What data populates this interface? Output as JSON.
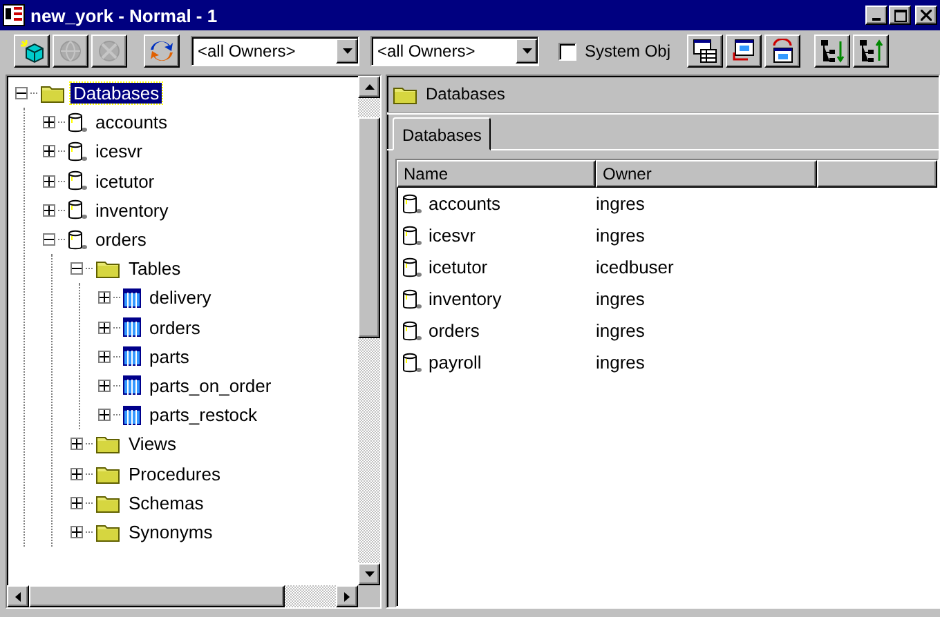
{
  "window": {
    "title": "new_york - Normal - 1"
  },
  "toolbar": {
    "left_buttons": [
      {
        "kind": "connect",
        "disabled": false
      },
      {
        "kind": "disconnect",
        "disabled": true
      },
      {
        "kind": "disconnect-all",
        "disabled": true
      }
    ],
    "refresh_button": {
      "kind": "refresh",
      "disabled": false
    },
    "owner_filters": [
      {
        "value": "<all Owners>"
      },
      {
        "value": "<all Owners>"
      }
    ],
    "system_obj": {
      "label": "System Obj",
      "checked": false
    },
    "right_buttons": [
      {
        "kind": "window-table",
        "disabled": false
      },
      {
        "kind": "window-move",
        "disabled": false
      },
      {
        "kind": "window-swap",
        "disabled": false
      },
      {
        "kind": "tree-down",
        "disabled": false
      },
      {
        "kind": "tree-up",
        "disabled": false
      }
    ]
  },
  "tree": {
    "items": [
      {
        "label": "Databases",
        "kind": "folder",
        "expanded": true,
        "selected": true,
        "children": [
          {
            "label": "accounts",
            "kind": "database",
            "expanded": false,
            "selected": false
          },
          {
            "label": "icesvr",
            "kind": "database",
            "expanded": false,
            "selected": false
          },
          {
            "label": "icetutor",
            "kind": "database",
            "expanded": false,
            "selected": false
          },
          {
            "label": "inventory",
            "kind": "database",
            "expanded": false,
            "selected": false
          },
          {
            "label": "orders",
            "kind": "database",
            "expanded": true,
            "selected": false,
            "children": [
              {
                "label": "Tables",
                "kind": "folder",
                "expanded": true,
                "selected": false,
                "children": [
                  {
                    "label": "delivery",
                    "kind": "table",
                    "expanded": false,
                    "selected": false
                  },
                  {
                    "label": "orders",
                    "kind": "table",
                    "expanded": false,
                    "selected": false
                  },
                  {
                    "label": "parts",
                    "kind": "table",
                    "expanded": false,
                    "selected": false
                  },
                  {
                    "label": "parts_on_order",
                    "kind": "table",
                    "expanded": false,
                    "selected": false
                  },
                  {
                    "label": "parts_restock",
                    "kind": "table",
                    "expanded": false,
                    "selected": false
                  }
                ]
              },
              {
                "label": "Views",
                "kind": "folder",
                "expanded": false,
                "selected": false
              },
              {
                "label": "Procedures",
                "kind": "folder",
                "expanded": false,
                "selected": false
              },
              {
                "label": "Schemas",
                "kind": "folder",
                "expanded": false,
                "selected": false
              },
              {
                "label": "Synonyms",
                "kind": "folder",
                "expanded": false,
                "selected": false
              }
            ]
          }
        ]
      }
    ]
  },
  "detail": {
    "header": "Databases",
    "tabs": [
      {
        "label": "Databases",
        "selected": true
      }
    ],
    "table": {
      "columns": [
        "Name",
        "Owner"
      ],
      "rows": [
        {
          "name": "accounts",
          "owner": "ingres"
        },
        {
          "name": "icesvr",
          "owner": "ingres"
        },
        {
          "name": "icetutor",
          "owner": "icedbuser"
        },
        {
          "name": "inventory",
          "owner": "ingres"
        },
        {
          "name": "orders",
          "owner": "ingres"
        },
        {
          "name": "payroll",
          "owner": "ingres"
        }
      ]
    }
  }
}
